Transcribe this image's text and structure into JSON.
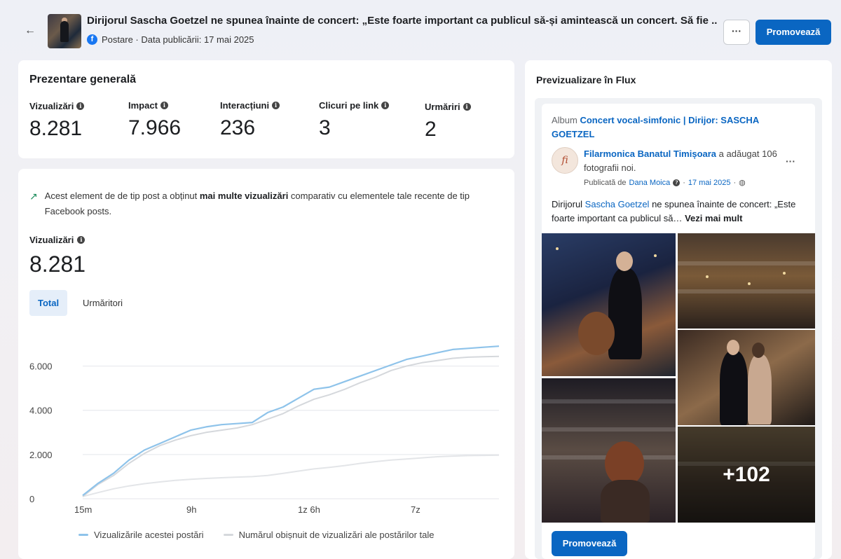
{
  "header": {
    "title": "Dirijorul Sascha Goetzel ne spunea înainte de concert: „Este foarte important ca publicul să-și amintească un concert. Să fie ...",
    "meta": "Postare · Data publicării: 17 mai 2025",
    "more_label": "···",
    "promote_label": "Promovează"
  },
  "overview": {
    "title": "Prezentare generală",
    "metrics": [
      {
        "label": "Vizualizări",
        "value": "8.281"
      },
      {
        "label": "Impact",
        "value": "7.966"
      },
      {
        "label": "Interacțiuni",
        "value": "236"
      },
      {
        "label": "Clicuri pe link",
        "value": "3"
      },
      {
        "label": "Urmăriri",
        "value": "2"
      }
    ]
  },
  "insight": {
    "text_before": "Acest element de de tip post a obținut ",
    "text_bold": "mai multe vizualizări",
    "text_after": " comparativ cu elementele tale recente de tip Facebook posts."
  },
  "views": {
    "label": "Vizualizări",
    "value": "8.281",
    "tabs": [
      "Total",
      "Urmăritori"
    ]
  },
  "chart_data": {
    "type": "line",
    "x_ticks": [
      "15m",
      "9h",
      "1z 6h",
      "7z"
    ],
    "y_ticks": [
      "0",
      "2.000",
      "4.000",
      "6.000"
    ],
    "ylim": [
      0,
      7000
    ],
    "grid": true,
    "legend_position": "bottom",
    "series": [
      {
        "name": "Vizualizările acestei postări",
        "color": "#8ec3ea",
        "values": [
          150,
          700,
          1150,
          1750,
          2200,
          2500,
          2800,
          3100,
          3250,
          3350,
          3400,
          3450,
          3900,
          4150,
          4550,
          4950,
          5050,
          5300,
          5550,
          5800,
          6050,
          6300,
          6450,
          6600,
          6750,
          6800,
          6850,
          6900
        ]
      },
      {
        "name": "Numărul obișnuit de vizualizări ale postărilor tale",
        "color": "#d5d8dc",
        "values": [
          100,
          650,
          1050,
          1600,
          2050,
          2400,
          2650,
          2850,
          3000,
          3100,
          3200,
          3350,
          3600,
          3850,
          4200,
          4500,
          4700,
          4950,
          5250,
          5500,
          5800,
          6000,
          6150,
          6250,
          6350,
          6400,
          6420,
          6440
        ]
      },
      {
        "name": "",
        "color": "#e3e5e8",
        "values": [
          100,
          280,
          450,
          580,
          680,
          760,
          830,
          880,
          920,
          950,
          980,
          1000,
          1050,
          1150,
          1250,
          1350,
          1420,
          1500,
          1600,
          1680,
          1750,
          1800,
          1850,
          1900,
          1930,
          1950,
          1960,
          1970
        ]
      }
    ]
  },
  "preview": {
    "title": "Previzualizare în Flux",
    "album_prefix": "Album ",
    "album_name": "Concert vocal-simfonic | Dirijor: SASCHA GOETZEL",
    "page_name": "Filarmonica Banatul Timișoara",
    "page_action": " a adăugat 106 fotografii noi.",
    "published_by_prefix": "Publicată de ",
    "published_by": "Dana Moica",
    "published_date": "17 mai 2025",
    "text_prefix": "Dirijorul ",
    "text_link": "Sascha Goetzel",
    "text_rest": " ne spunea înainte de concert: „Este foarte important ca publicul să…",
    "see_more": "Vezi mai mult",
    "more_photos": "+102",
    "promote_label": "Promovează",
    "post_more_label": "···"
  }
}
